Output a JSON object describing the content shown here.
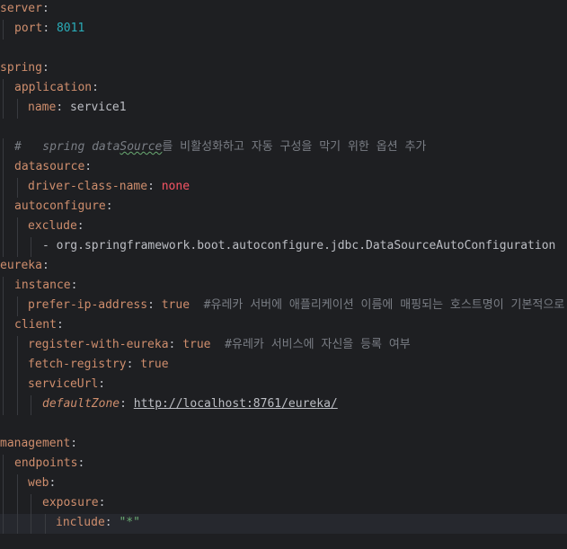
{
  "editor": {
    "language": "yaml",
    "lines": [
      {
        "indent": 0,
        "tokens": [
          {
            "t": "server",
            "c": "key"
          },
          {
            "t": ":",
            "c": "colon"
          }
        ]
      },
      {
        "indent": 1,
        "tokens": [
          {
            "t": "port",
            "c": "key"
          },
          {
            "t": ": ",
            "c": "colon"
          },
          {
            "t": "8011",
            "c": "num"
          }
        ]
      },
      {
        "indent": 0,
        "tokens": []
      },
      {
        "indent": 0,
        "tokens": [
          {
            "t": "spring",
            "c": "key"
          },
          {
            "t": ":",
            "c": "colon"
          }
        ]
      },
      {
        "indent": 1,
        "tokens": [
          {
            "t": "application",
            "c": "key"
          },
          {
            "t": ":",
            "c": "colon"
          }
        ]
      },
      {
        "indent": 2,
        "tokens": [
          {
            "t": "name",
            "c": "key"
          },
          {
            "t": ": ",
            "c": "colon"
          },
          {
            "t": "service1",
            "c": "str"
          }
        ]
      },
      {
        "indent": 0,
        "tokens": []
      },
      {
        "indent": 1,
        "tokens": [
          {
            "t": "#   spring data",
            "c": "comment-it"
          },
          {
            "t": "Source",
            "c": "comment-it typo"
          },
          {
            "t": "를 비활성화하고 자동 구성을 막기 위한 옵션 추가",
            "c": "comment"
          }
        ]
      },
      {
        "indent": 1,
        "tokens": [
          {
            "t": "datasource",
            "c": "key"
          },
          {
            "t": ":",
            "c": "colon"
          }
        ]
      },
      {
        "indent": 2,
        "tokens": [
          {
            "t": "driver-class-name",
            "c": "key"
          },
          {
            "t": ": ",
            "c": "colon"
          },
          {
            "t": "none",
            "c": "none"
          }
        ]
      },
      {
        "indent": 1,
        "tokens": [
          {
            "t": "autoconfigure",
            "c": "key"
          },
          {
            "t": ":",
            "c": "colon"
          }
        ]
      },
      {
        "indent": 2,
        "tokens": [
          {
            "t": "exclude",
            "c": "key"
          },
          {
            "t": ":",
            "c": "colon"
          }
        ]
      },
      {
        "indent": 3,
        "tokens": [
          {
            "t": "- ",
            "c": "dash"
          },
          {
            "t": "org.springframework.boot.autoconfigure.jdbc.DataSourceAutoConfiguration",
            "c": "str"
          }
        ]
      },
      {
        "indent": 0,
        "tokens": [
          {
            "t": "eureka",
            "c": "key"
          },
          {
            "t": ":",
            "c": "colon"
          }
        ]
      },
      {
        "indent": 1,
        "tokens": [
          {
            "t": "instance",
            "c": "key"
          },
          {
            "t": ":",
            "c": "colon"
          }
        ]
      },
      {
        "indent": 2,
        "tokens": [
          {
            "t": "prefer-ip-address",
            "c": "key"
          },
          {
            "t": ": ",
            "c": "colon"
          },
          {
            "t": "true",
            "c": "bool"
          },
          {
            "t": "  #유레카 서버에 애플리케이션 이름에 매핑되는 호스트명이 기본적으로 등록",
            "c": "comment"
          }
        ]
      },
      {
        "indent": 1,
        "tokens": [
          {
            "t": "client",
            "c": "key"
          },
          {
            "t": ":",
            "c": "colon"
          }
        ]
      },
      {
        "indent": 2,
        "tokens": [
          {
            "t": "register-with-eureka",
            "c": "key"
          },
          {
            "t": ": ",
            "c": "colon"
          },
          {
            "t": "true",
            "c": "bool"
          },
          {
            "t": "  #유레카 서비스에 자신을 등록 여부",
            "c": "comment"
          }
        ]
      },
      {
        "indent": 2,
        "tokens": [
          {
            "t": "fetch-registry",
            "c": "key"
          },
          {
            "t": ": ",
            "c": "colon"
          },
          {
            "t": "true",
            "c": "bool"
          }
        ]
      },
      {
        "indent": 2,
        "tokens": [
          {
            "t": "serviceUrl",
            "c": "key"
          },
          {
            "t": ":",
            "c": "colon"
          }
        ]
      },
      {
        "indent": 3,
        "tokens": [
          {
            "t": "defaultZone",
            "c": "italic-key"
          },
          {
            "t": ": ",
            "c": "colon"
          },
          {
            "t": "http://localhost:8761/eureka/",
            "c": "url"
          }
        ]
      },
      {
        "indent": 0,
        "tokens": []
      },
      {
        "indent": 0,
        "tokens": [
          {
            "t": "management",
            "c": "key"
          },
          {
            "t": ":",
            "c": "colon"
          }
        ]
      },
      {
        "indent": 1,
        "tokens": [
          {
            "t": "endpoints",
            "c": "key"
          },
          {
            "t": ":",
            "c": "colon"
          }
        ]
      },
      {
        "indent": 2,
        "tokens": [
          {
            "t": "web",
            "c": "key"
          },
          {
            "t": ":",
            "c": "colon"
          }
        ]
      },
      {
        "indent": 3,
        "tokens": [
          {
            "t": "exposure",
            "c": "key"
          },
          {
            "t": ":",
            "c": "colon"
          }
        ]
      },
      {
        "indent": 4,
        "tokens": [
          {
            "t": "include",
            "c": "key"
          },
          {
            "t": ": ",
            "c": "colon"
          },
          {
            "t": "\"*\"",
            "c": "quoted"
          }
        ],
        "current": true
      },
      {
        "indent": 0,
        "tokens": []
      }
    ]
  },
  "colors": {
    "background": "#1e1f22",
    "key": "#cf8e6d",
    "number": "#2aacb8",
    "string": "#bcbec4",
    "none": "#f75464",
    "quoted": "#6aab73",
    "comment": "#7a7e85",
    "current_line": "#26282e"
  }
}
